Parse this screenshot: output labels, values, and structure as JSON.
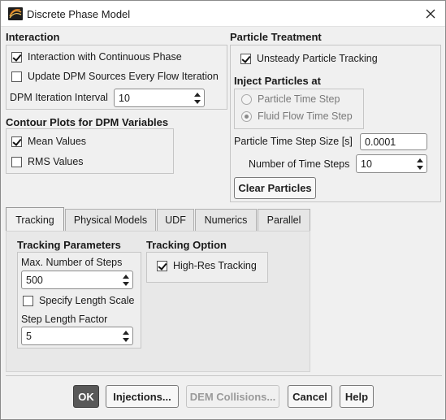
{
  "window": {
    "title": "Discrete Phase Model"
  },
  "interaction": {
    "heading": "Interaction",
    "interaction_with_continuous_phase": {
      "label": "Interaction with Continuous Phase",
      "checked": true
    },
    "update_dpm_sources": {
      "label": "Update DPM Sources Every Flow Iteration",
      "checked": false
    },
    "dpm_iteration_interval": {
      "label": "DPM Iteration Interval",
      "value": "10"
    }
  },
  "contour_plots": {
    "heading": "Contour Plots for DPM Variables",
    "mean_values": {
      "label": "Mean Values",
      "checked": true
    },
    "rms_values": {
      "label": "RMS Values",
      "checked": false
    }
  },
  "particle_treatment": {
    "heading": "Particle Treatment",
    "unsteady_tracking": {
      "label": "Unsteady Particle Tracking",
      "checked": true
    },
    "inject_heading": "Inject Particles at",
    "particle_time_step": {
      "label": "Particle Time Step",
      "selected": false
    },
    "fluid_flow_time_step": {
      "label": "Fluid Flow Time Step",
      "selected": true
    },
    "time_step_size": {
      "label": "Particle Time Step Size [s]",
      "value": "0.0001"
    },
    "number_of_time_steps": {
      "label": "Number of Time Steps",
      "value": "10"
    },
    "clear_button": "Clear Particles"
  },
  "tabs": [
    "Tracking",
    "Physical Models",
    "UDF",
    "Numerics",
    "Parallel"
  ],
  "active_tab": "Tracking",
  "tracking": {
    "params_heading": "Tracking Parameters",
    "max_steps": {
      "label": "Max. Number of Steps",
      "value": "500"
    },
    "specify_length_scale": {
      "label": "Specify Length Scale",
      "checked": false
    },
    "step_length_factor": {
      "label": "Step Length Factor",
      "value": "5"
    },
    "option_heading": "Tracking Option",
    "high_res": {
      "label": "High-Res Tracking",
      "checked": true
    }
  },
  "footer": {
    "ok": "OK",
    "injections": "Injections...",
    "dem_collisions": "DEM Collisions...",
    "cancel": "Cancel",
    "help": "Help"
  },
  "colors": {
    "accent": "#585858",
    "disabled_text": "#9a9a9a",
    "panel": "#f0f0f0"
  },
  "icons": {
    "app": "fluent-logo-icon",
    "close": "close-icon"
  }
}
